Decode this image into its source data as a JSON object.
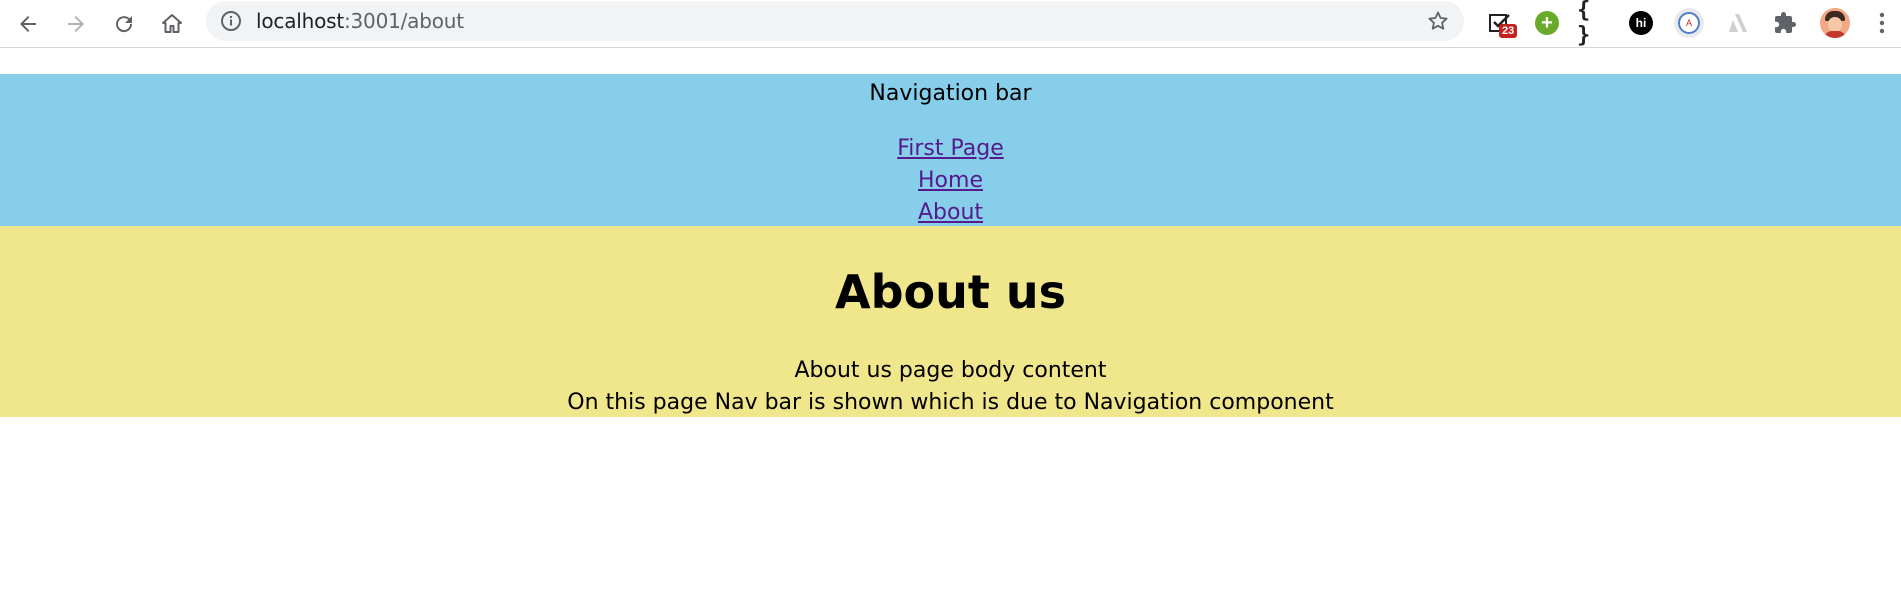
{
  "browser": {
    "url_host": "localhost",
    "url_path": ":3001/about",
    "badge_count": "23",
    "hi_label": "hi",
    "braces_label": "{ }"
  },
  "nav": {
    "title": "Navigation bar",
    "links": [
      "First Page",
      "Home",
      "About"
    ],
    "background": "#87ceeb",
    "link_color": "#551a8b"
  },
  "main": {
    "heading": "About us",
    "lines": [
      "About us page body content",
      "On this page Nav bar is shown which is due to Navigation component"
    ],
    "background": "#f0e68c"
  }
}
